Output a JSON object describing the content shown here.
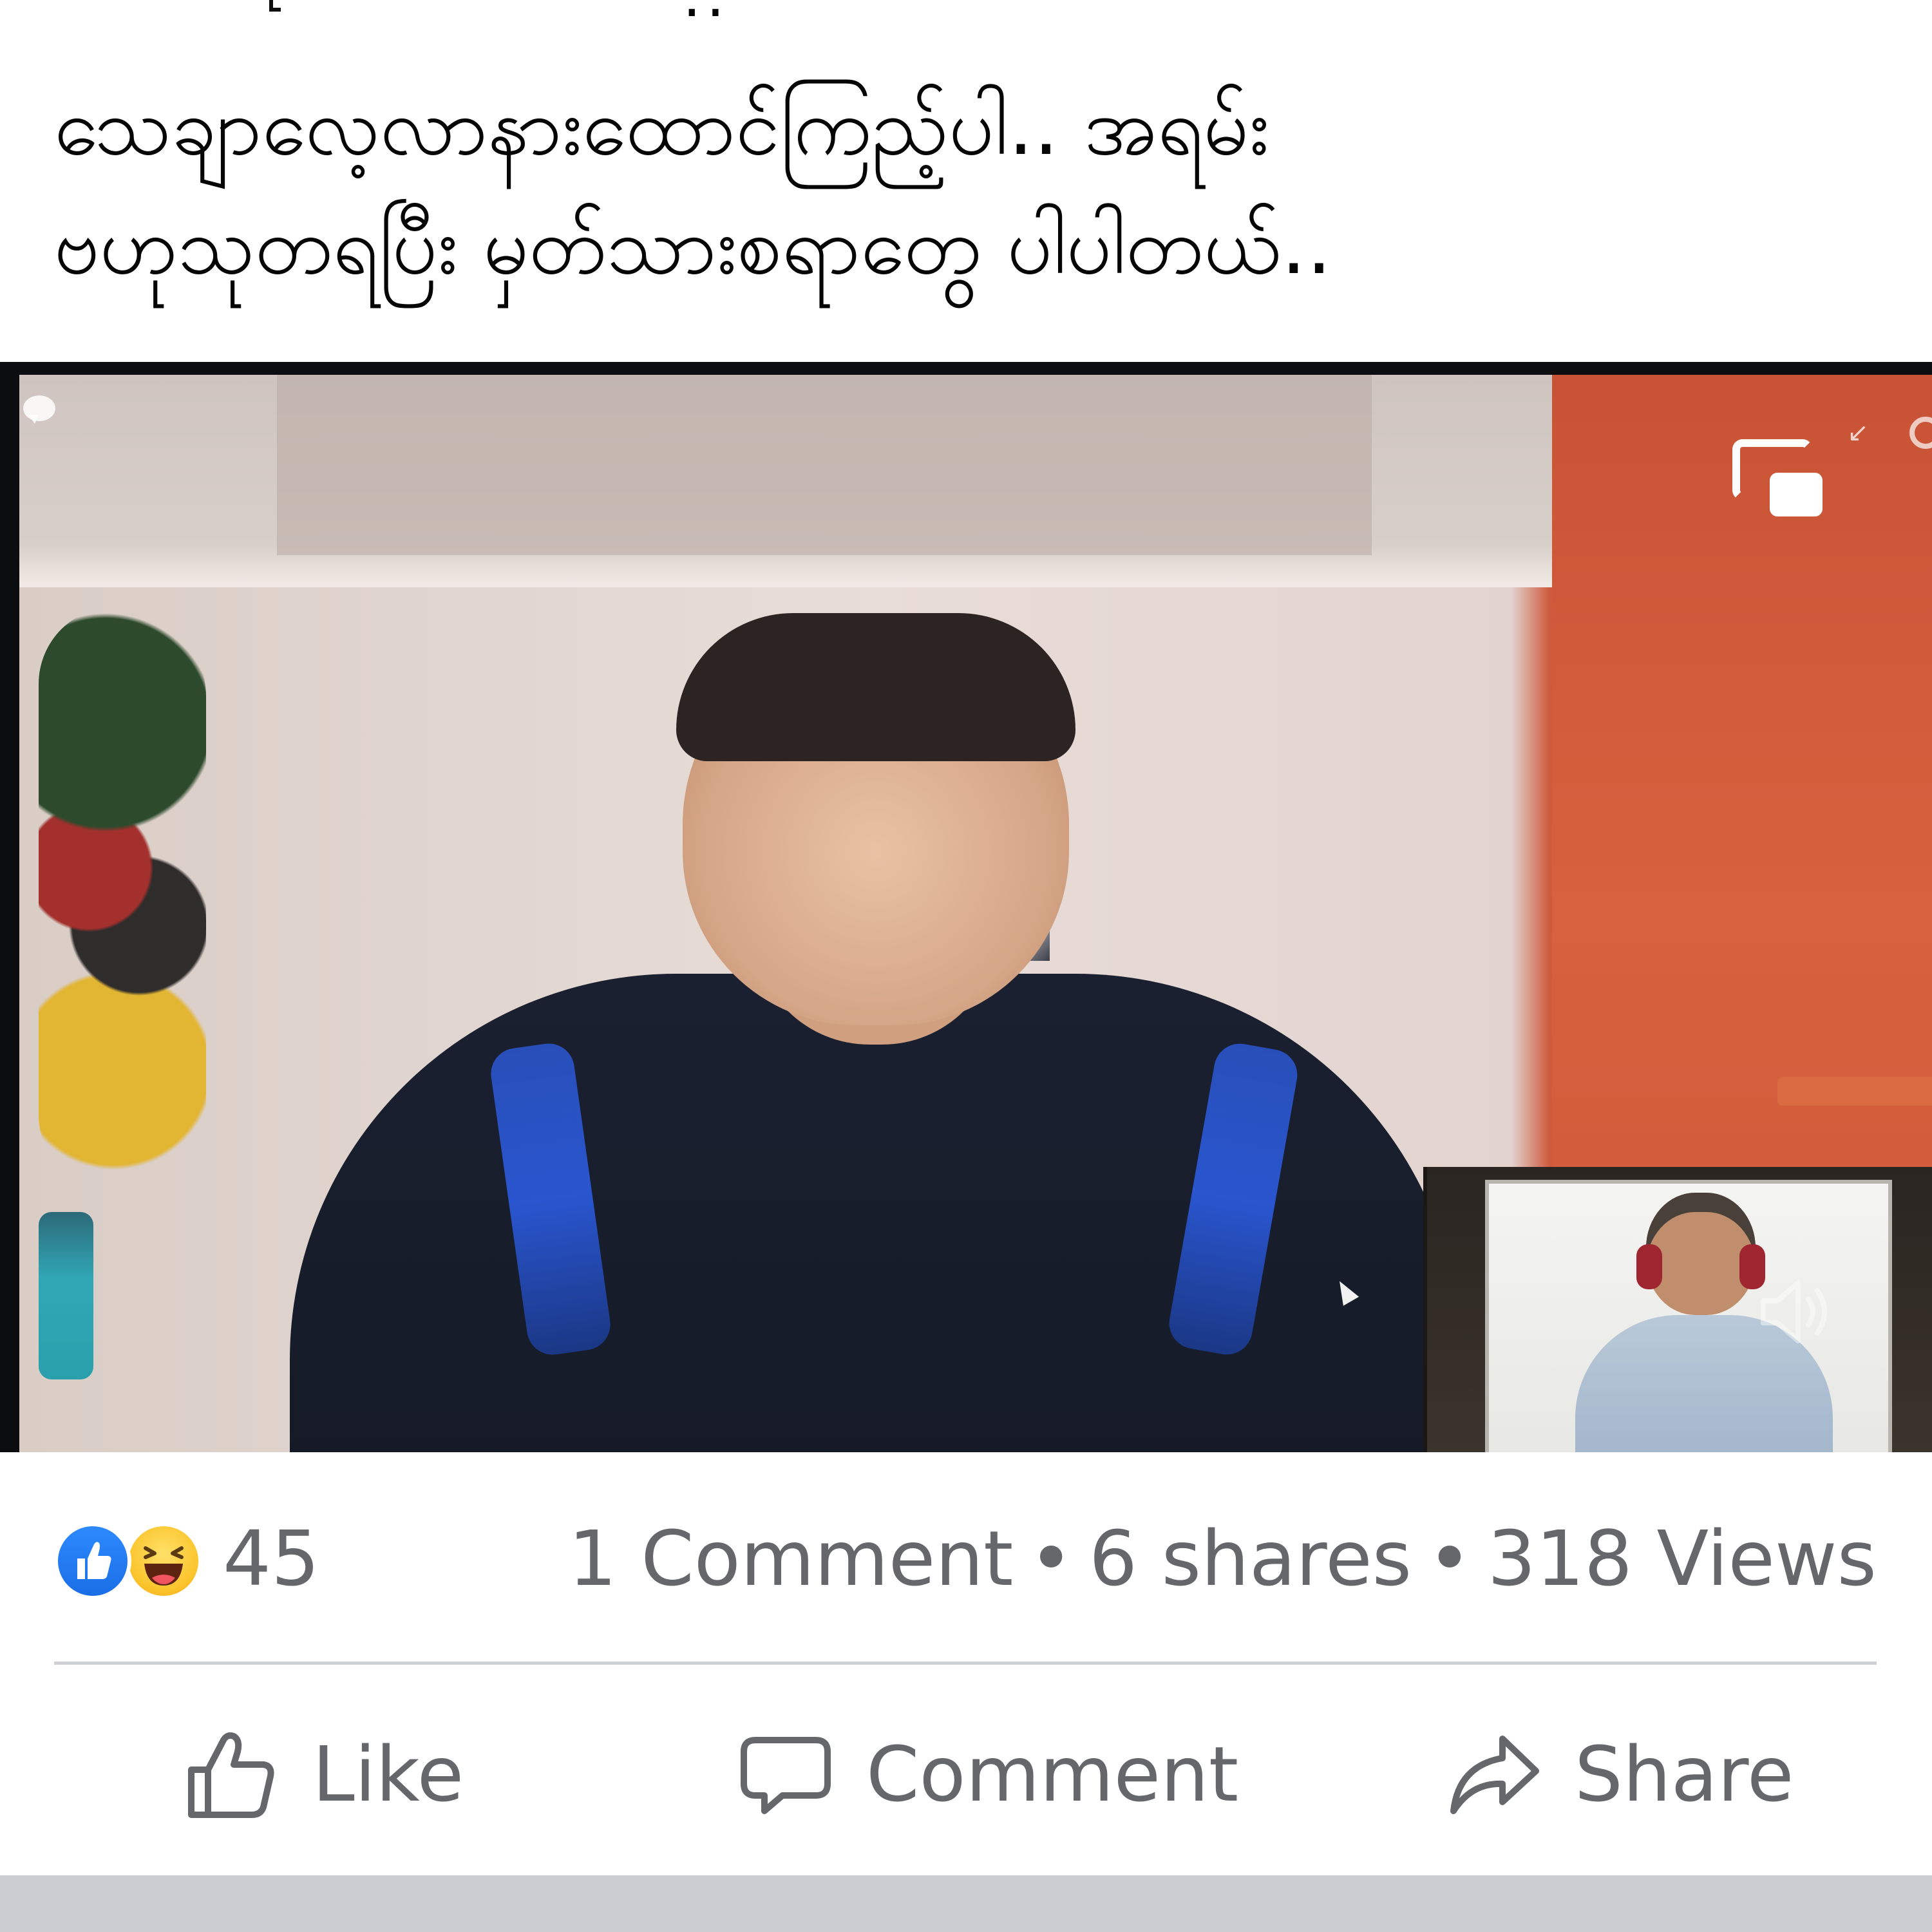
{
  "post": {
    "caption_fragment": "..",
    "caption_line1": "သေချာလေ့လာနားထောင်ကြည့်ပါ.. အရမ်း",
    "caption_line2": "ဗဟုသုတရပြီး မှတ်သားစရာတွေ ပါပါတယ်.."
  },
  "video": {
    "icons": {
      "chat": "chat-bubble-icon",
      "pip_toggle": "picture-in-picture-icon",
      "minimize": "minimize-icon",
      "settings": "settings-icon",
      "volume": "volume-icon",
      "cursor": "cursor-icon"
    }
  },
  "reactions": {
    "icons": [
      "like-reaction-icon",
      "haha-reaction-icon"
    ],
    "count": "45"
  },
  "stats": {
    "comments": "1 Comment",
    "separator": "•",
    "shares": "6 shares",
    "views": "318 Views"
  },
  "actions": {
    "like": "Like",
    "comment": "Comment",
    "share": "Share"
  },
  "colors": {
    "secondary_text": "#65676b",
    "like_blue": "#1a6ee6",
    "haha_yellow": "#fbc52d",
    "divider": "#ced0d4",
    "feed_gap": "#c9ccd1"
  }
}
